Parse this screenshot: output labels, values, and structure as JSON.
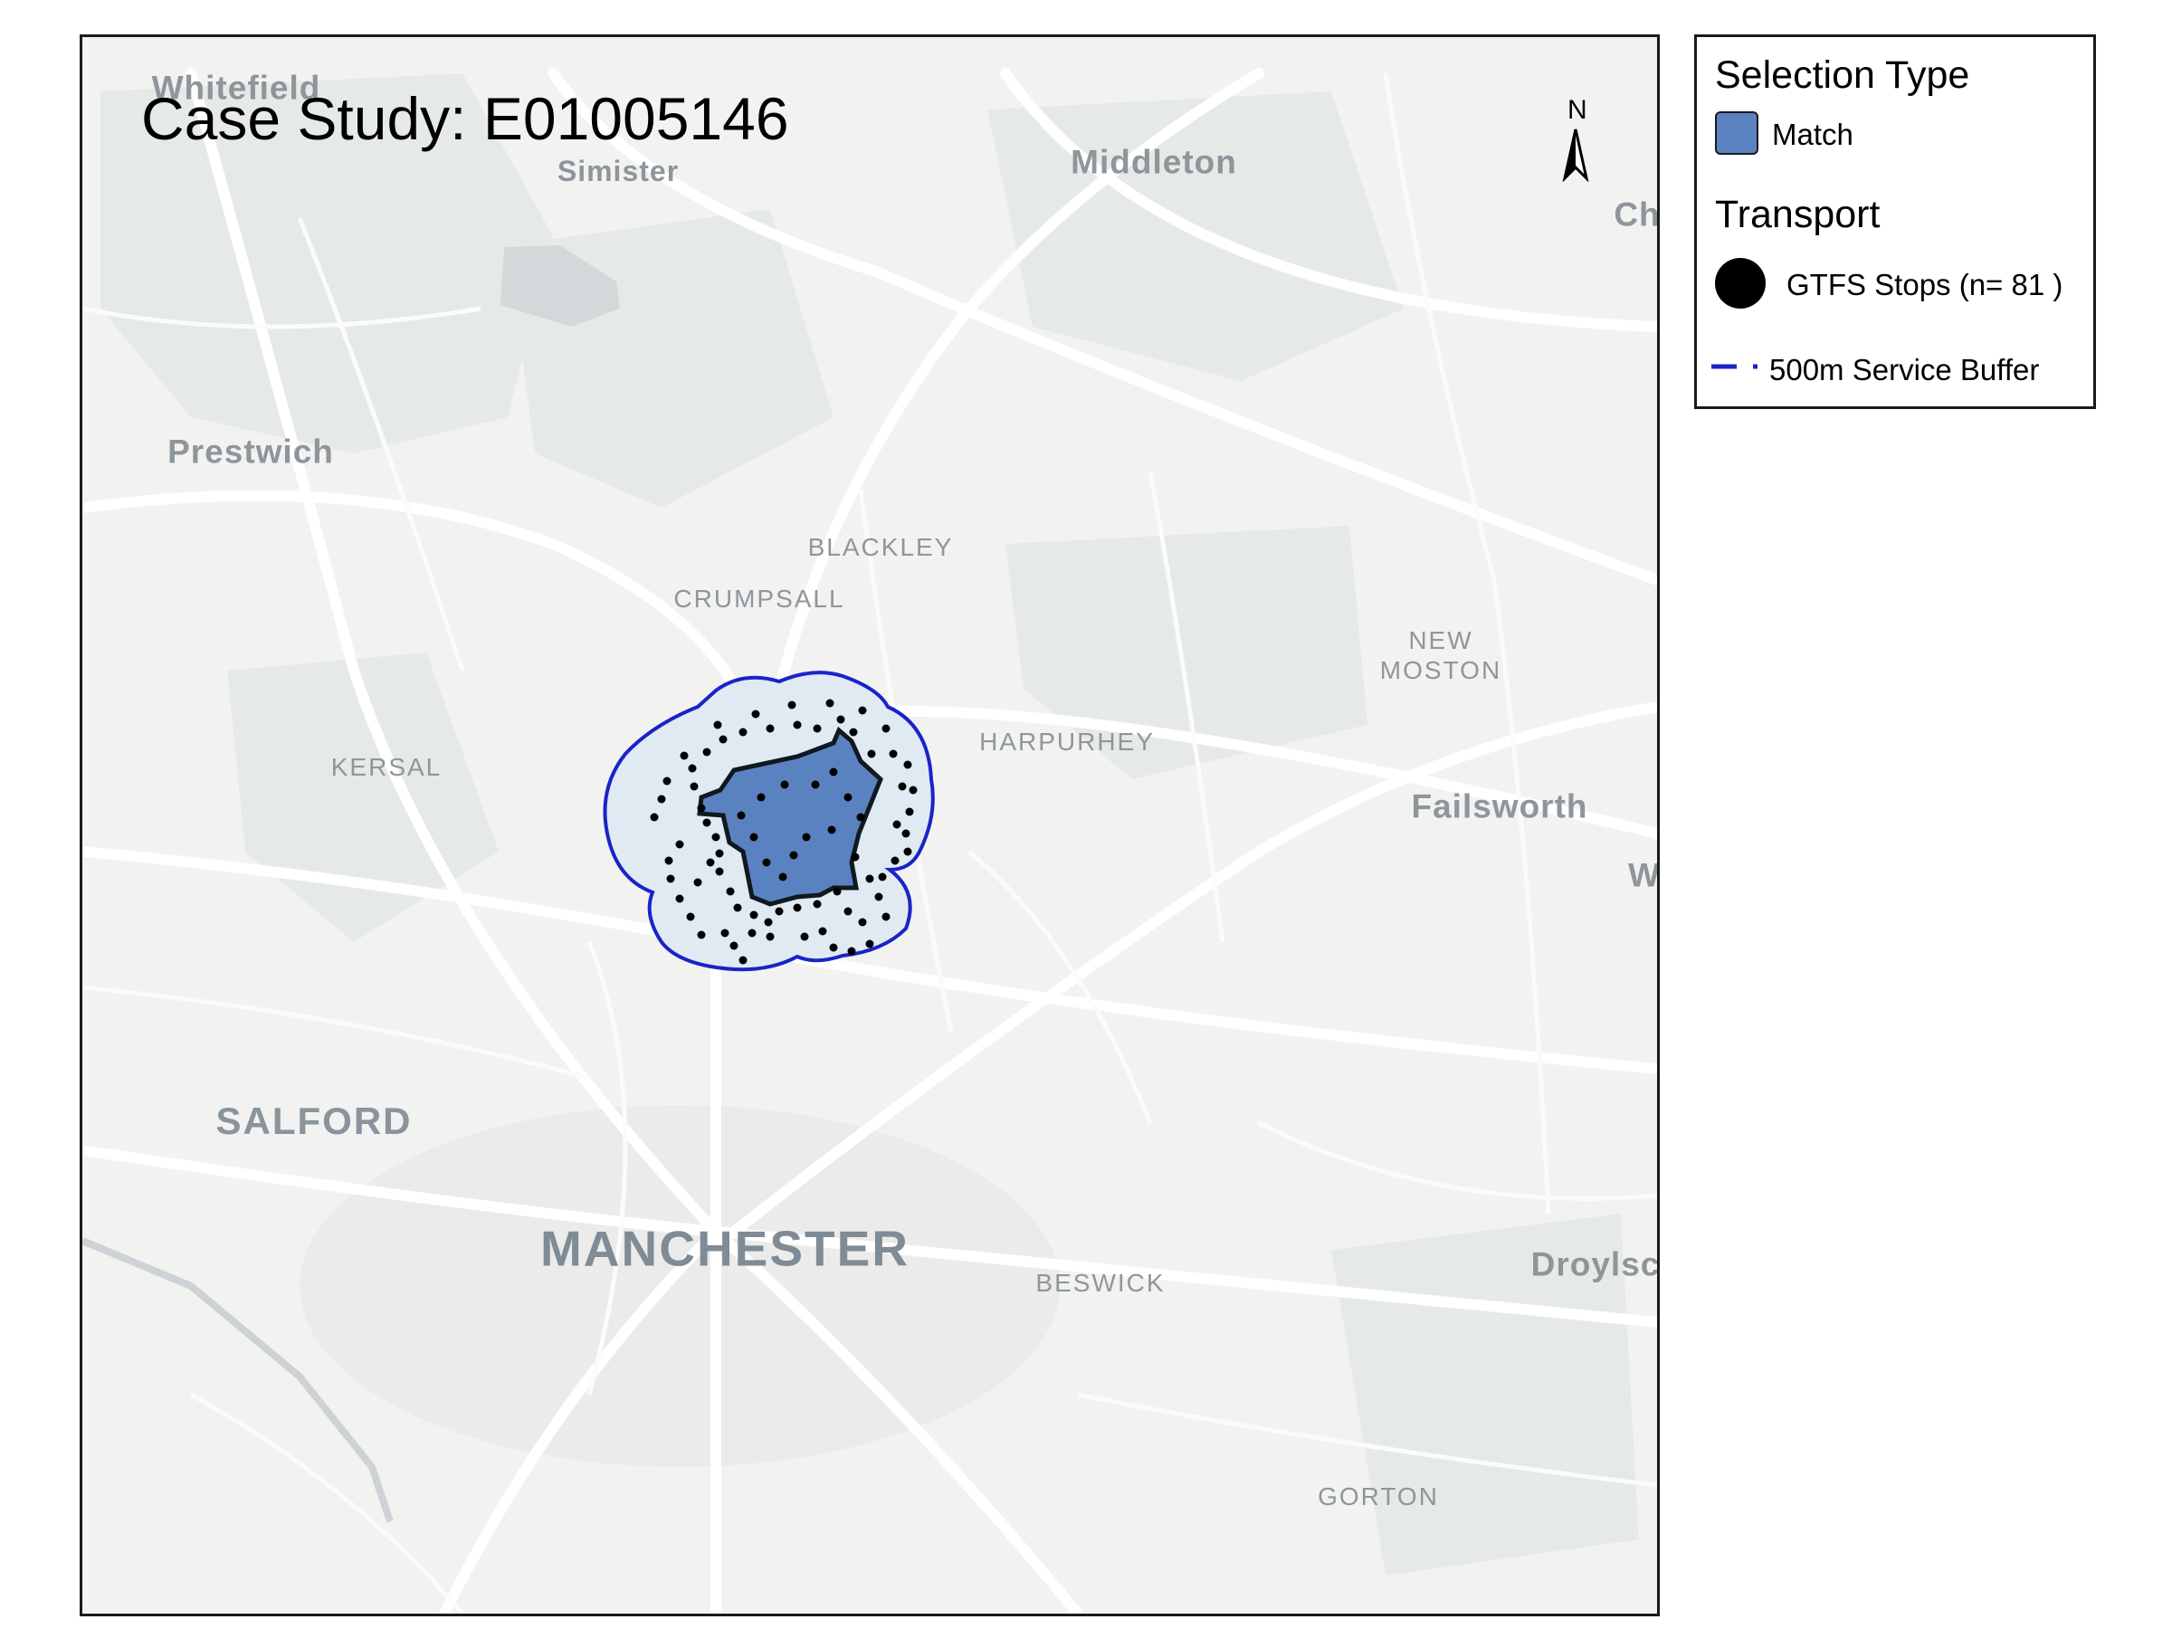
{
  "map": {
    "title": "Case Study: E01005146",
    "north_label": "N",
    "places": {
      "whitefield": "Whitefield",
      "simister": "Simister",
      "middleton": "Middleton",
      "ch": "Ch",
      "prestwich": "Prestwich",
      "blackley": "BLACKLEY",
      "crumpsall": "CRUMPSALL",
      "new_moston_1": "NEW",
      "new_moston_2": "MOSTON",
      "harpurhey": "HARPURHEY",
      "kersal": "KERSAL",
      "failsworth": "Failsworth",
      "w": "W",
      "salford": "SALFORD",
      "manchester": "MANCHESTER",
      "beswick": "BESWICK",
      "droylsden": "Droylsc",
      "gorton": "GORTON"
    }
  },
  "legend": {
    "selection_title": "Selection Type",
    "match_label": "Match",
    "transport_title": "Transport",
    "stops_label": "GTFS Stops (n= 81 )",
    "buffer_label": "500m Service Buffer"
  },
  "colors": {
    "match_fill": "#5b82c0",
    "buffer_fill": "#dfeaf2",
    "buffer_stroke": "#1a23c8",
    "stop": "#000000"
  }
}
